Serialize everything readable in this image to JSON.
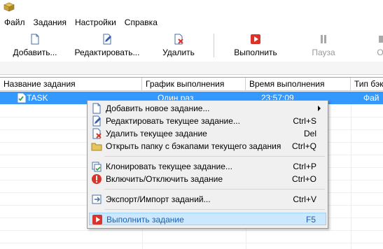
{
  "menu": [
    "Файл",
    "Задания",
    "Настройки",
    "Справка"
  ],
  "toolbar": {
    "add": "Добавить...",
    "edit": "Редактировать...",
    "delete": "Удалить",
    "run": "Выполнить",
    "pause": "Пауза",
    "stop": "Ос"
  },
  "columns": [
    "Название задания",
    "График выполнения",
    "Время выполнения",
    "Тип бэк"
  ],
  "task_row": {
    "name": "TASK",
    "schedule": "Один раз",
    "time": "23:57:09",
    "type": "Фай"
  },
  "context_menu": {
    "items": [
      {
        "label": "Добавить новое задание...",
        "shortcut": "",
        "icon": "add-doc-icon"
      },
      {
        "label": "Редактировать текущее задание...",
        "shortcut": "Ctrl+S",
        "icon": "pencil-icon"
      },
      {
        "label": "Удалить текущее задание",
        "shortcut": "Del",
        "icon": "delete-doc-icon"
      },
      {
        "label": "Открыть папку с бэкапами текущего задания",
        "shortcut": "Ctrl+Q",
        "icon": "folder-icon"
      },
      {
        "label": "Клонировать текущее задание...",
        "shortcut": "Ctrl+P",
        "icon": "clone-icon"
      },
      {
        "label": "Включить/Отключить задание",
        "shortcut": "Ctrl+O",
        "icon": "toggle-icon"
      },
      {
        "label": "Экспорт/Импорт заданий...",
        "shortcut": "Ctrl+V",
        "icon": "export-icon"
      },
      {
        "label": "Выполнить задание",
        "shortcut": "F5",
        "icon": "run-icon"
      }
    ]
  },
  "colors": {
    "selection": "#3399ff",
    "highlight": "#cce8ff",
    "run_red": "#d9342b"
  }
}
